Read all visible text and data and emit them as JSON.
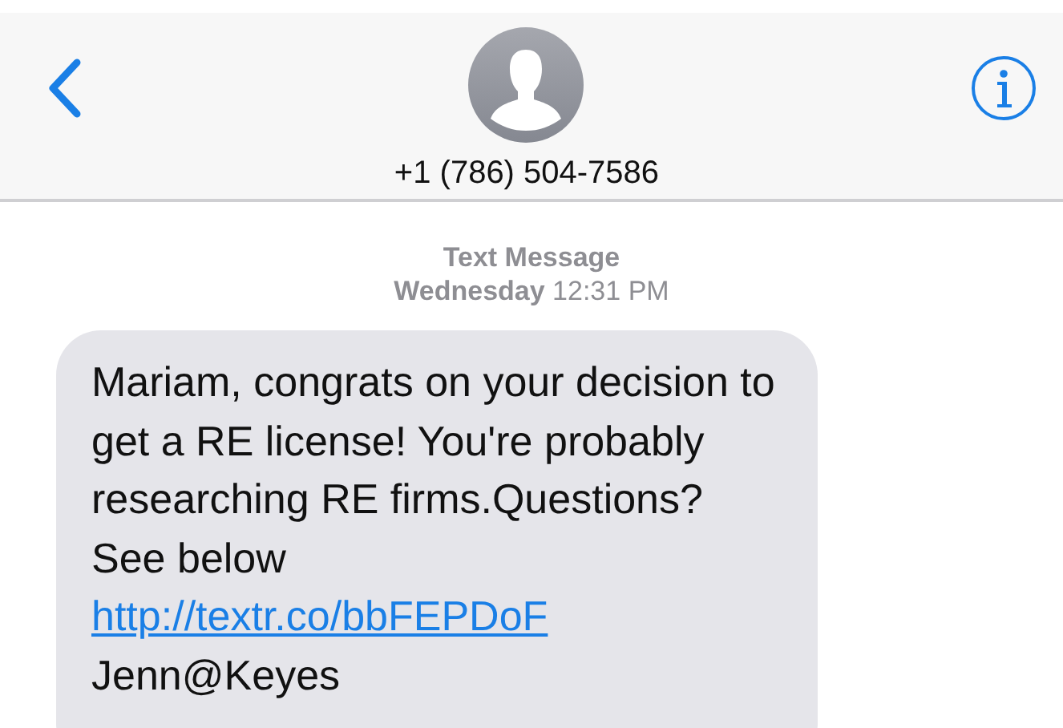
{
  "header": {
    "contact": "+1 (786) 504-7586"
  },
  "conversation": {
    "service": "Text Message",
    "timestamp": "**Wednesday** 12:31 PM"
  },
  "messages": [
    {
      "kind": "incoming",
      "text": "Mariam, congrats on your decision to get a RE license! You're probably researching RE firms.Questions? See below",
      "link": "http://textr.co/bbFEPDoF",
      "signature": "Jenn@Keyes"
    }
  ]
}
